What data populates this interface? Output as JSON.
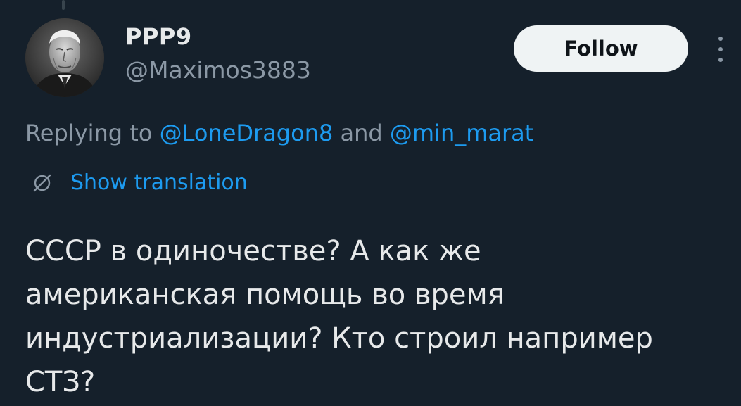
{
  "author": {
    "display_name": "PPP9",
    "handle": "@Maximos3883",
    "avatar_icon": "avatar-portrait"
  },
  "follow_button": {
    "label": "Follow"
  },
  "more_menu": {
    "icon": "more-vertical-icon"
  },
  "reply": {
    "prefix": "Replying to ",
    "mentions": [
      "@LoneDragon8",
      "@min_marat"
    ],
    "conjunction": " and "
  },
  "translation": {
    "icon": "translate-icon",
    "label": "Show translation"
  },
  "tweet": {
    "lines": [
      "СССР в одиночестве? А как же",
      "американская помощь во время",
      "индустриализации? Кто строил например",
      "СТЗ?"
    ]
  },
  "colors": {
    "background": "#15202b",
    "primary_text": "#e7e9ea",
    "secondary_text": "#8b98a5",
    "accent": "#1d9bf0",
    "button_bg": "#eff3f4"
  }
}
